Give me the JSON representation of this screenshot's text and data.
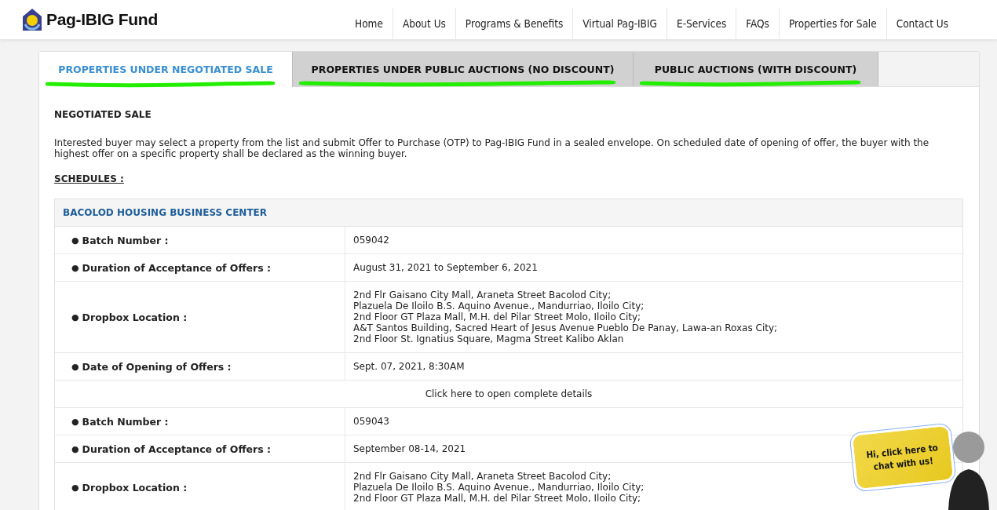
{
  "bullet": "●",
  "logo": {
    "text": "Pag-IBIG Fund"
  },
  "nav": [
    {
      "label": "Home"
    },
    {
      "label": "About Us"
    },
    {
      "label": "Programs & Benefits"
    },
    {
      "label": "Virtual Pag-IBIG"
    },
    {
      "label": "E-Services"
    },
    {
      "label": "FAQs"
    },
    {
      "label": "Properties for Sale"
    },
    {
      "label": "Contact Us"
    }
  ],
  "tabs": [
    {
      "label": "PROPERTIES UNDER NEGOTIATED SALE",
      "selected": true,
      "highlighted": true
    },
    {
      "label": "PROPERTIES UNDER PUBLIC AUCTIONS (NO DISCOUNT)",
      "selected": false,
      "highlighted": true
    },
    {
      "label": "PUBLIC AUCTIONS (WITH DISCOUNT)",
      "selected": false,
      "highlighted": true
    }
  ],
  "section_title": "NEGOTIATED SALE",
  "intro": "Interested buyer may select a property from the list and submit Offer to Purchase (OTP) to Pag-IBIG Fund in a sealed envelope. On scheduled date of opening of offer, the buyer with the highest offer on a specific property shall be declared as the winning buyer.",
  "schedules_label": "SCHEDULES :",
  "schedule": {
    "center": "BACOLOD HOUSING BUSINESS CENTER",
    "batches": [
      {
        "fields": [
          {
            "label": "Batch Number :",
            "lines": [
              "059042"
            ]
          },
          {
            "label": "Duration of Acceptance of Offers :",
            "lines": [
              "August 31, 2021 to September 6, 2021"
            ]
          },
          {
            "label": "Dropbox Location :",
            "lines": [
              "2nd Flr Gaisano City Mall, Araneta Street Bacolod City;",
              "Plazuela De Iloilo B.S. Aquino Avenue., Mandurriao, Iloilo City;",
              "2nd Floor GT Plaza Mall, M.H. del Pilar Street Molo, Iloilo City;",
              "A&T Santos Building, Sacred Heart of Jesus Avenue Pueblo De Panay, Lawa-an Roxas City;",
              "2nd Floor St. Ignatius Square, Magma Street Kalibo Aklan"
            ]
          },
          {
            "label": "Date of Opening of Offers :",
            "lines": [
              "Sept. 07, 2021, 8:30AM"
            ]
          }
        ],
        "link": "Click here to open complete details"
      },
      {
        "fields": [
          {
            "label": "Batch Number :",
            "lines": [
              "059043"
            ]
          },
          {
            "label": "Duration of Acceptance of Offers :",
            "lines": [
              "September 08-14, 2021"
            ]
          },
          {
            "label": "Dropbox Location :",
            "lines": [
              "2nd Flr Gaisano City Mall, Araneta Street Bacolod City;",
              "Plazuela De Iloilo B.S. Aquino Avenue., Mandurriao, Iloilo City;",
              "2nd Floor GT Plaza Mall, M.H. del Pilar Street Molo, Iloilo City;"
            ]
          }
        ]
      }
    ]
  },
  "chat": {
    "text": "Hi, click here to chat with us!"
  }
}
